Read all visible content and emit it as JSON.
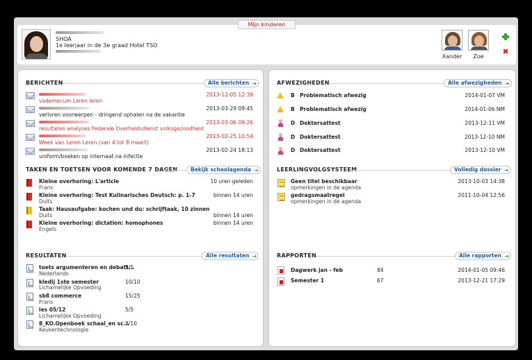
{
  "header": {
    "tab_label": "Mijn kinderen",
    "student_name": "SHOA",
    "student_class": "1e leerjaar in de 3e graad Hotel TSO",
    "children": [
      {
        "name": "Xander"
      },
      {
        "name": "Zoe"
      }
    ]
  },
  "berichten": {
    "title": "BERICHTEN",
    "button": "Alle berichten",
    "items": [
      {
        "subject": "vademecum Leren leren",
        "date": "2013-12-05 12:39",
        "unread": true
      },
      {
        "subject": "verloren voorwerpen - dringend ophalen na de vakantie",
        "date": "2013-03-29 09:45",
        "unread": false
      },
      {
        "subject": "resultaten analyses Federale Overheidsdienst volksgezondheid",
        "date": "2013-03-06 09:26",
        "unread": true
      },
      {
        "subject": "Week van Leren Leren (van 4 tot 8 maart)",
        "date": "2013-02-25 10:54",
        "unread": true
      },
      {
        "subject": "uniform/boeken op internaat na infectie",
        "date": "2013-02-24 18:13",
        "unread": false
      }
    ]
  },
  "taken": {
    "title": "TAKEN EN TOETSEN VOOR KOMENDE 7 DAGEN",
    "button": "Bekijk schoolagenda",
    "items": [
      {
        "title": "Kleine overhoring: L'article",
        "subject": "Frans",
        "when": "10 uren geleden",
        "color": "red"
      },
      {
        "title": "Kleine overhoring: Test Kulinarisches Deutsch: p. 1-7",
        "subject": "Duits",
        "when": "binnen 14 uren",
        "color": "red"
      },
      {
        "title": "Taak: Hausaufgabe: kochen und du: schrijftaak, 10 zinnen",
        "subject": "Duits",
        "when": "binnen 14 uren",
        "color": "yellow"
      },
      {
        "title": "Kleine overhoring: dictation: homophones",
        "subject": "Engels",
        "when": "binnen 14 uren",
        "color": "red"
      }
    ]
  },
  "resultaten": {
    "title": "RESULTATEN",
    "button": "Alle resultaten",
    "items": [
      {
        "title": "toets argumenteren en debatt...",
        "subject": "Nederlands",
        "score": "5/5"
      },
      {
        "title": "kledij 1ste semester",
        "subject": "Lichamelijke Opvoeding",
        "score": "10/10"
      },
      {
        "title": "sb8 commerce",
        "subject": "Frans",
        "score": "15/25"
      },
      {
        "title": "les 05/12",
        "subject": "Lichamelijke Opvoeding",
        "score": "5/5"
      },
      {
        "title": "8_KO.Openboek schaal_en sc...",
        "subject": "Keukentechnologie",
        "score": "8/10"
      }
    ]
  },
  "afwezigheden": {
    "title": "AFWEZIGHEDEN",
    "button": "Alle afwezigheden",
    "items": [
      {
        "code": "B",
        "label": "Problematisch afwezig",
        "date": "2014-01-07 VM",
        "icon": "warning-icon"
      },
      {
        "code": "B",
        "label": "Problematisch afwezig",
        "date": "2014-01-06 NM",
        "icon": "warning-icon"
      },
      {
        "code": "D",
        "label": "Doktersattest",
        "date": "2013-12-11 VM",
        "icon": "doctor-icon"
      },
      {
        "code": "D",
        "label": "Doktersattest",
        "date": "2013-12-10 NM",
        "icon": "doctor-icon"
      },
      {
        "code": "D",
        "label": "Doktersattest",
        "date": "2013-12-10 VM",
        "icon": "doctor-icon"
      }
    ]
  },
  "leerlingvolgsysteem": {
    "title": "LEERLINGVOLGSYSTEEM",
    "button": "Volledig dossier",
    "items": [
      {
        "title": "Geen titel beschikbaar",
        "sub": "opmerkingen in de agenda",
        "date": "2013-10-03 14:38"
      },
      {
        "title": "gedragsmaatregel",
        "sub": "opmerkingen in de agenda",
        "date": "2011-10-04 12:56"
      }
    ]
  },
  "rapporten": {
    "title": "RAPPORTEN",
    "button": "Alle rapporten",
    "items": [
      {
        "title": "Dagwerk jan - feb",
        "score": "84",
        "date": "2014-01-05 09:46"
      },
      {
        "title": "Semester 1",
        "score": "67",
        "date": "2013-12-21 17:29"
      }
    ]
  },
  "colors": {
    "accent_red": "#d83232",
    "link_blue": "#1b5fa8",
    "arrow_green": "#3ca33c"
  }
}
